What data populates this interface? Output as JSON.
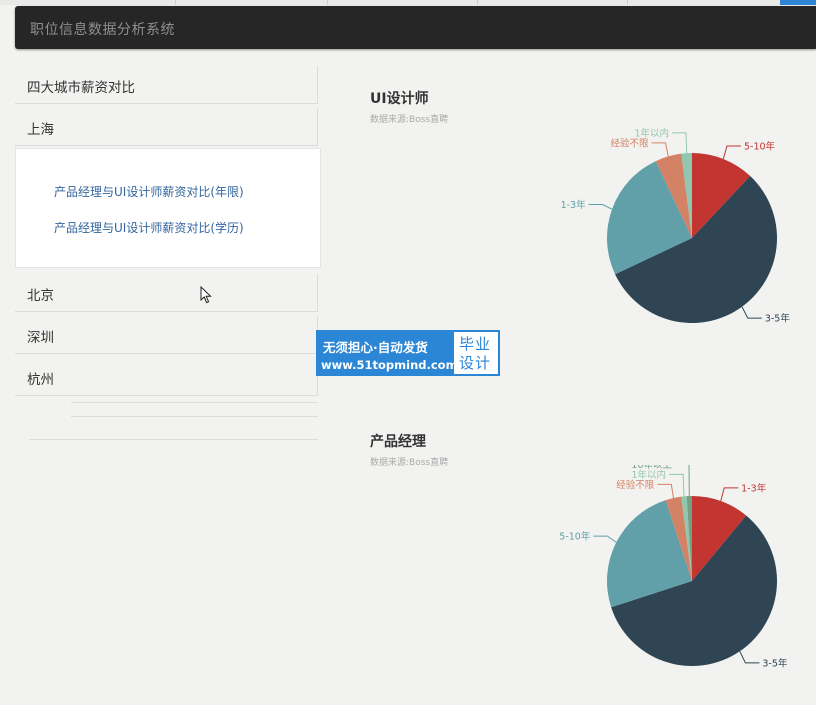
{
  "app": {
    "title": "职位信息数据分析系统"
  },
  "sidebar": {
    "items": [
      {
        "label": "四大城市薪资对比"
      },
      {
        "label": "上海"
      },
      {
        "label": "北京"
      },
      {
        "label": "深圳"
      },
      {
        "label": "杭州"
      }
    ],
    "sublinks": [
      {
        "label": "产品经理与UI设计师薪资对比(年限)"
      },
      {
        "label": "产品经理与UI设计师薪资对比(学历)"
      }
    ]
  },
  "charts": [
    {
      "title": "UI设计师",
      "subtitle": "数据来源:Boss直聘"
    },
    {
      "title": "产品经理",
      "subtitle": "数据来源:Boss直聘"
    }
  ],
  "chart_data": [
    {
      "type": "pie",
      "title": "UI设计师",
      "subtitle": "数据来源:Boss直聘",
      "series": [
        {
          "name": "5-10年",
          "value": 12,
          "color": "#c23531"
        },
        {
          "name": "3-5年",
          "value": 56,
          "color": "#2f4554"
        },
        {
          "name": "1-3年",
          "value": 25,
          "color": "#61a0a8"
        },
        {
          "name": "经验不限",
          "value": 5,
          "color": "#d48265"
        },
        {
          "name": "1年以内",
          "value": 2,
          "color": "#91c7ae"
        }
      ]
    },
    {
      "type": "pie",
      "title": "产品经理",
      "subtitle": "数据来源:Boss直聘",
      "series": [
        {
          "name": "1-3年",
          "value": 11,
          "color": "#c23531"
        },
        {
          "name": "3-5年",
          "value": 59,
          "color": "#2f4554"
        },
        {
          "name": "5-10年",
          "value": 25,
          "color": "#61a0a8"
        },
        {
          "name": "经验不限",
          "value": 3,
          "color": "#d48265"
        },
        {
          "name": "1年以内",
          "value": 1,
          "color": "#91c7ae"
        },
        {
          "name": "10年以上",
          "value": 1,
          "color": "#749f83"
        }
      ]
    }
  ],
  "watermark": {
    "line1": "无须担心·自动发货",
    "line2": "www.51topmind.com",
    "right1": "毕业",
    "right2": "设计"
  }
}
